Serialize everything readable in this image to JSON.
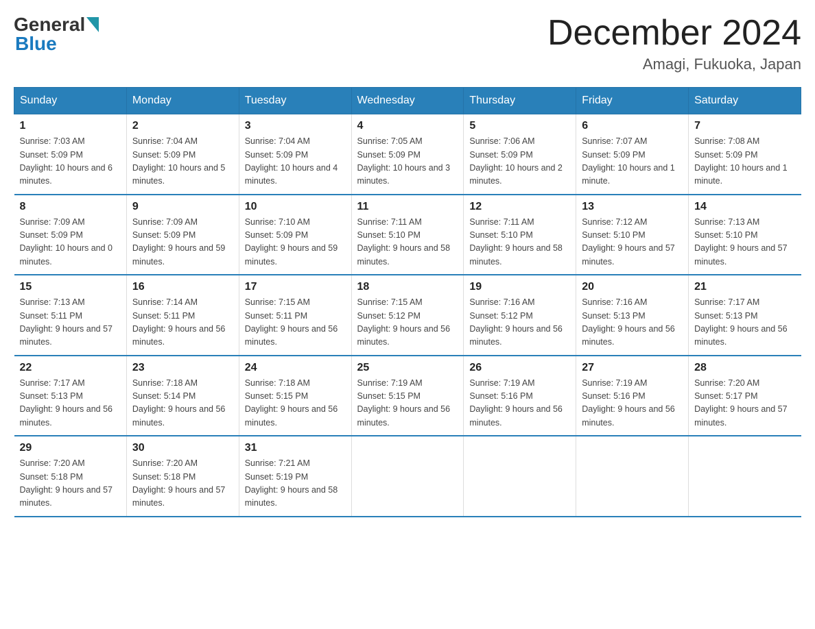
{
  "header": {
    "logo_general": "General",
    "logo_blue": "Blue",
    "month_title": "December 2024",
    "location": "Amagi, Fukuoka, Japan"
  },
  "days_of_week": [
    "Sunday",
    "Monday",
    "Tuesday",
    "Wednesday",
    "Thursday",
    "Friday",
    "Saturday"
  ],
  "weeks": [
    [
      {
        "day": "1",
        "sunrise": "7:03 AM",
        "sunset": "5:09 PM",
        "daylight": "10 hours and 6 minutes."
      },
      {
        "day": "2",
        "sunrise": "7:04 AM",
        "sunset": "5:09 PM",
        "daylight": "10 hours and 5 minutes."
      },
      {
        "day": "3",
        "sunrise": "7:04 AM",
        "sunset": "5:09 PM",
        "daylight": "10 hours and 4 minutes."
      },
      {
        "day": "4",
        "sunrise": "7:05 AM",
        "sunset": "5:09 PM",
        "daylight": "10 hours and 3 minutes."
      },
      {
        "day": "5",
        "sunrise": "7:06 AM",
        "sunset": "5:09 PM",
        "daylight": "10 hours and 2 minutes."
      },
      {
        "day": "6",
        "sunrise": "7:07 AM",
        "sunset": "5:09 PM",
        "daylight": "10 hours and 1 minute."
      },
      {
        "day": "7",
        "sunrise": "7:08 AM",
        "sunset": "5:09 PM",
        "daylight": "10 hours and 1 minute."
      }
    ],
    [
      {
        "day": "8",
        "sunrise": "7:09 AM",
        "sunset": "5:09 PM",
        "daylight": "10 hours and 0 minutes."
      },
      {
        "day": "9",
        "sunrise": "7:09 AM",
        "sunset": "5:09 PM",
        "daylight": "9 hours and 59 minutes."
      },
      {
        "day": "10",
        "sunrise": "7:10 AM",
        "sunset": "5:09 PM",
        "daylight": "9 hours and 59 minutes."
      },
      {
        "day": "11",
        "sunrise": "7:11 AM",
        "sunset": "5:10 PM",
        "daylight": "9 hours and 58 minutes."
      },
      {
        "day": "12",
        "sunrise": "7:11 AM",
        "sunset": "5:10 PM",
        "daylight": "9 hours and 58 minutes."
      },
      {
        "day": "13",
        "sunrise": "7:12 AM",
        "sunset": "5:10 PM",
        "daylight": "9 hours and 57 minutes."
      },
      {
        "day": "14",
        "sunrise": "7:13 AM",
        "sunset": "5:10 PM",
        "daylight": "9 hours and 57 minutes."
      }
    ],
    [
      {
        "day": "15",
        "sunrise": "7:13 AM",
        "sunset": "5:11 PM",
        "daylight": "9 hours and 57 minutes."
      },
      {
        "day": "16",
        "sunrise": "7:14 AM",
        "sunset": "5:11 PM",
        "daylight": "9 hours and 56 minutes."
      },
      {
        "day": "17",
        "sunrise": "7:15 AM",
        "sunset": "5:11 PM",
        "daylight": "9 hours and 56 minutes."
      },
      {
        "day": "18",
        "sunrise": "7:15 AM",
        "sunset": "5:12 PM",
        "daylight": "9 hours and 56 minutes."
      },
      {
        "day": "19",
        "sunrise": "7:16 AM",
        "sunset": "5:12 PM",
        "daylight": "9 hours and 56 minutes."
      },
      {
        "day": "20",
        "sunrise": "7:16 AM",
        "sunset": "5:13 PM",
        "daylight": "9 hours and 56 minutes."
      },
      {
        "day": "21",
        "sunrise": "7:17 AM",
        "sunset": "5:13 PM",
        "daylight": "9 hours and 56 minutes."
      }
    ],
    [
      {
        "day": "22",
        "sunrise": "7:17 AM",
        "sunset": "5:13 PM",
        "daylight": "9 hours and 56 minutes."
      },
      {
        "day": "23",
        "sunrise": "7:18 AM",
        "sunset": "5:14 PM",
        "daylight": "9 hours and 56 minutes."
      },
      {
        "day": "24",
        "sunrise": "7:18 AM",
        "sunset": "5:15 PM",
        "daylight": "9 hours and 56 minutes."
      },
      {
        "day": "25",
        "sunrise": "7:19 AM",
        "sunset": "5:15 PM",
        "daylight": "9 hours and 56 minutes."
      },
      {
        "day": "26",
        "sunrise": "7:19 AM",
        "sunset": "5:16 PM",
        "daylight": "9 hours and 56 minutes."
      },
      {
        "day": "27",
        "sunrise": "7:19 AM",
        "sunset": "5:16 PM",
        "daylight": "9 hours and 56 minutes."
      },
      {
        "day": "28",
        "sunrise": "7:20 AM",
        "sunset": "5:17 PM",
        "daylight": "9 hours and 57 minutes."
      }
    ],
    [
      {
        "day": "29",
        "sunrise": "7:20 AM",
        "sunset": "5:18 PM",
        "daylight": "9 hours and 57 minutes."
      },
      {
        "day": "30",
        "sunrise": "7:20 AM",
        "sunset": "5:18 PM",
        "daylight": "9 hours and 57 minutes."
      },
      {
        "day": "31",
        "sunrise": "7:21 AM",
        "sunset": "5:19 PM",
        "daylight": "9 hours and 58 minutes."
      },
      null,
      null,
      null,
      null
    ]
  ],
  "labels": {
    "sunrise_prefix": "Sunrise: ",
    "sunset_prefix": "Sunset: ",
    "daylight_prefix": "Daylight: "
  }
}
